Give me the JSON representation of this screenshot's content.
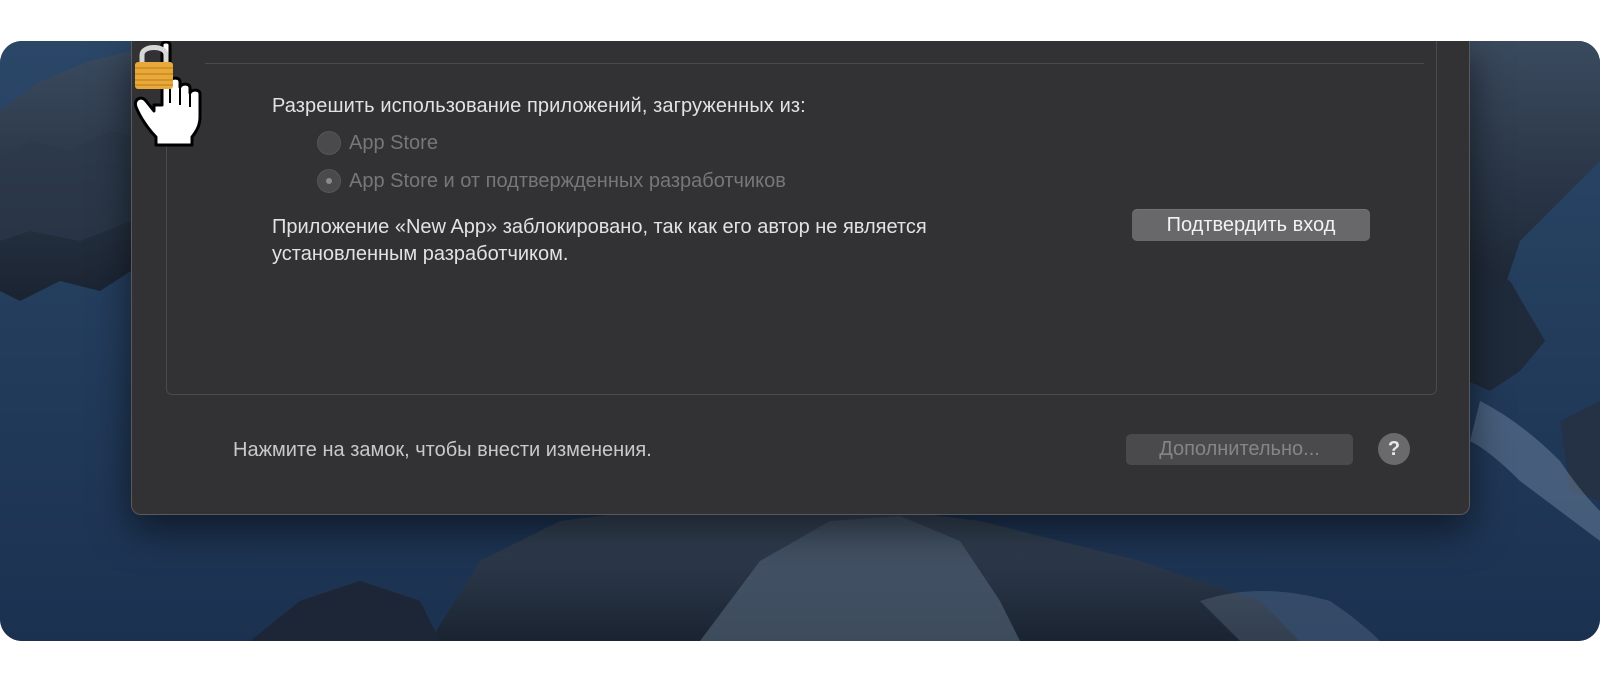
{
  "security": {
    "allow_heading": "Разрешить использование приложений, загруженных из:",
    "options": [
      {
        "label": "App Store",
        "selected": false,
        "enabled": false
      },
      {
        "label": "App Store и от подтвержденных разработчиков",
        "selected": true,
        "enabled": false
      }
    ],
    "blocked_message": "Приложение «New App» заблокировано, так как его автор не является установленным разработчиком.",
    "allow_button_label": "Подтвердить вход"
  },
  "footer": {
    "lock_text": "Нажмите на замок, чтобы внести изменения.",
    "advanced_button_label": "Дополнительно...",
    "help_button_label": "?"
  },
  "icons": {
    "lock": "lock-icon",
    "pointer": "hand-pointer-icon",
    "help": "question-mark"
  },
  "colors": {
    "window_bg": "#323234",
    "lock_gold": "#e9a93a"
  }
}
